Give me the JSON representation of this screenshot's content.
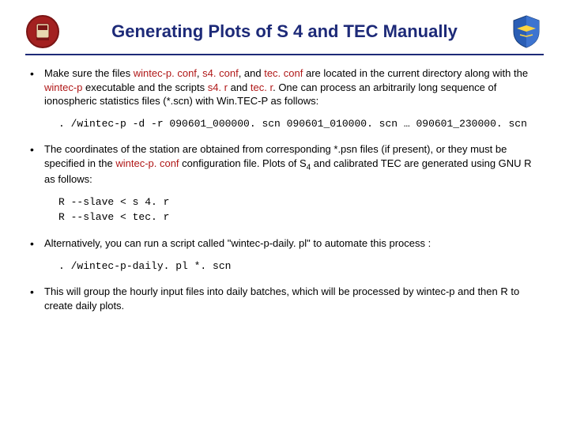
{
  "title": "Generating Plots of S 4 and TEC Manually",
  "bullets": {
    "b1": {
      "pre1": "Make sure the files ",
      "f1": "wintec-p. conf",
      "sep1": ", ",
      "f2": "s4. conf",
      "sep2": ", and ",
      "f3": "tec. conf",
      "post1": " are located in the current directory along with the ",
      "f4": "wintec-p",
      "post2": " executable and the scripts ",
      "f5": "s4. r",
      "sep3": " and ",
      "f6": "tec. r",
      "post3": ". One can process an arbitrarily long sequence of ionospheric statistics files (*.scn) with Win.TEC-P as follows:",
      "code": ". /wintec-p -d -r 090601_000000. scn 090601_010000. scn … 090601_230000. scn"
    },
    "b2": {
      "pre1": "The coordinates of the station are obtained from corresponding *.psn files (if present), or they must be specified in the ",
      "f1": "wintec-p. conf",
      "post1": " configuration file. Plots of S",
      "sub": "4",
      "post2": " and calibrated TEC are generated using GNU R as follows:",
      "code": "R --slave < s 4. r\nR --slave < tec. r"
    },
    "b3": {
      "text": "Alternatively, you can run a script called \"wintec-p-daily. pl\" to automate this process :",
      "code": ". /wintec-p-daily. pl *. scn"
    },
    "b4": {
      "text": "This will group the hourly input files into daily batches, which will be processed by wintec-p and then R to create daily plots."
    }
  }
}
